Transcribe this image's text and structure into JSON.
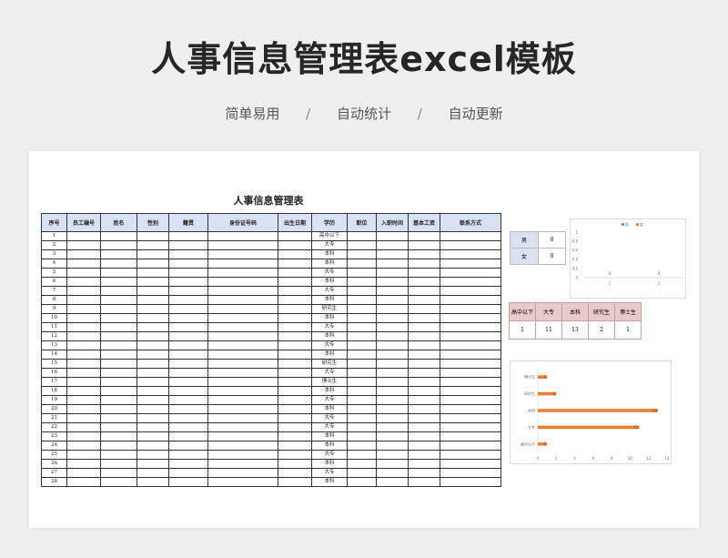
{
  "hero": {
    "title": "人事信息管理表excel模板",
    "sub1": "简单易用",
    "sub2": "自动统计",
    "sub3": "自动更新",
    "sep": "/"
  },
  "sheet": {
    "title": "人事信息管理表",
    "columns": [
      "序号",
      "员工编号",
      "姓名",
      "性别",
      "籍贯",
      "身份证号码",
      "出生日期",
      "学历",
      "职位",
      "入职时间",
      "基本工资",
      "联系方式"
    ],
    "rows": [
      {
        "no": "1",
        "edu": "高中以下"
      },
      {
        "no": "2",
        "edu": "大专"
      },
      {
        "no": "3",
        "edu": "本科"
      },
      {
        "no": "4",
        "edu": "本科"
      },
      {
        "no": "5",
        "edu": "大专"
      },
      {
        "no": "6",
        "edu": "本科"
      },
      {
        "no": "7",
        "edu": "大专"
      },
      {
        "no": "8",
        "edu": "本科"
      },
      {
        "no": "9",
        "edu": "研究生"
      },
      {
        "no": "10",
        "edu": "本科"
      },
      {
        "no": "11",
        "edu": "大专"
      },
      {
        "no": "12",
        "edu": "本科"
      },
      {
        "no": "13",
        "edu": "大专"
      },
      {
        "no": "14",
        "edu": "本科"
      },
      {
        "no": "15",
        "edu": "研究生"
      },
      {
        "no": "16",
        "edu": "大专"
      },
      {
        "no": "17",
        "edu": "博士生"
      },
      {
        "no": "18",
        "edu": "本科"
      },
      {
        "no": "19",
        "edu": "大专"
      },
      {
        "no": "20",
        "edu": "本科"
      },
      {
        "no": "21",
        "edu": "大专"
      },
      {
        "no": "22",
        "edu": "大专"
      },
      {
        "no": "23",
        "edu": "本科"
      },
      {
        "no": "24",
        "edu": "本科"
      },
      {
        "no": "25",
        "edu": "大专"
      },
      {
        "no": "26",
        "edu": "本科"
      },
      {
        "no": "27",
        "edu": "大专"
      },
      {
        "no": "28",
        "edu": "本科"
      }
    ]
  },
  "gender": {
    "male_label": "男",
    "male_value": "0",
    "female_label": "女",
    "female_value": "0"
  },
  "edu_summary": {
    "labels": [
      "高中以下",
      "大专",
      "本科",
      "研究生",
      "博士生"
    ],
    "values": [
      "1",
      "11",
      "13",
      "2",
      "1"
    ]
  },
  "colors": {
    "male": "#5b9bd5",
    "female": "#ed7d31",
    "header_blue": "#d9e2f3",
    "header_pink": "#e9caca"
  },
  "chart_data": [
    {
      "type": "bar",
      "legend": [
        "男",
        "女"
      ],
      "categories": [
        "1",
        "2"
      ],
      "series": [
        {
          "name": "男",
          "values": [
            0,
            0
          ]
        },
        {
          "name": "女",
          "values": [
            0,
            0
          ]
        }
      ],
      "data_labels": [
        "0",
        "0"
      ],
      "yticks": [
        "1",
        "0.8",
        "0.6",
        "0.4",
        "0.2",
        "0"
      ],
      "ylim": [
        0,
        1
      ],
      "legend_position": "top"
    },
    {
      "type": "bar",
      "orientation": "horizontal",
      "categories": [
        "博士生",
        "研究生",
        "本科",
        "大专",
        "高中以下"
      ],
      "values": [
        1,
        2,
        13,
        11,
        1
      ],
      "data_labels": [
        "1",
        "2",
        "13",
        "11",
        "1"
      ],
      "xticks": [
        "0",
        "2",
        "4",
        "6",
        "8",
        "10",
        "12",
        "14"
      ],
      "xlim": [
        0,
        14
      ]
    }
  ]
}
